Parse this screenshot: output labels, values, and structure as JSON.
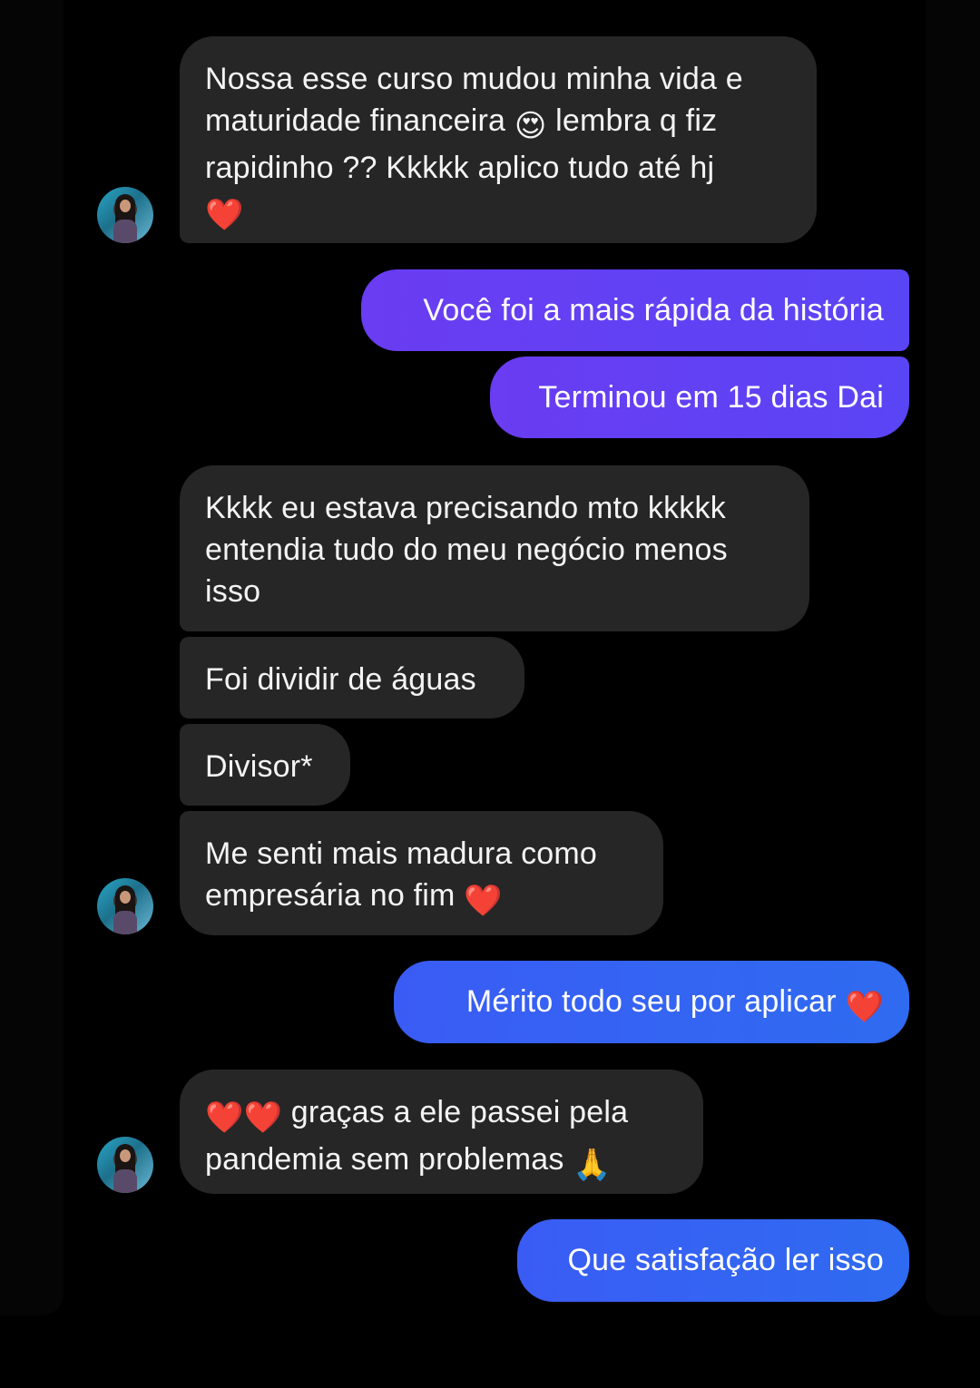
{
  "messages": [
    {
      "side": "in",
      "text": "Nossa esse curso mudou minha vida e maturidade financeira",
      "emoji1": "😍",
      "text2": "lembra q fiz rapidinho ?? Kkkkk aplico tudo até hj",
      "emoji2": "❤️"
    },
    {
      "side": "out",
      "text": "Você foi a mais rápida da história"
    },
    {
      "side": "out",
      "text": "Terminou em 15 dias Dai"
    },
    {
      "side": "in",
      "text": "Kkkk eu estava precisando mto kkkkk entendia tudo do meu negócio menos isso"
    },
    {
      "side": "in",
      "text": "Foi dividir de águas"
    },
    {
      "side": "in",
      "text": "Divisor*"
    },
    {
      "side": "in",
      "text": "Me senti mais madura como empresária no fim",
      "emoji": "❤️"
    },
    {
      "side": "out",
      "text": "Mérito todo seu por aplicar",
      "emoji": "❤️"
    },
    {
      "side": "in",
      "emoji": "❤️❤️",
      "text": "graças a ele passei pela pandemia sem problemas",
      "emoji2": "🙏"
    },
    {
      "side": "out",
      "text": "Que satisfação ler isso"
    }
  ]
}
